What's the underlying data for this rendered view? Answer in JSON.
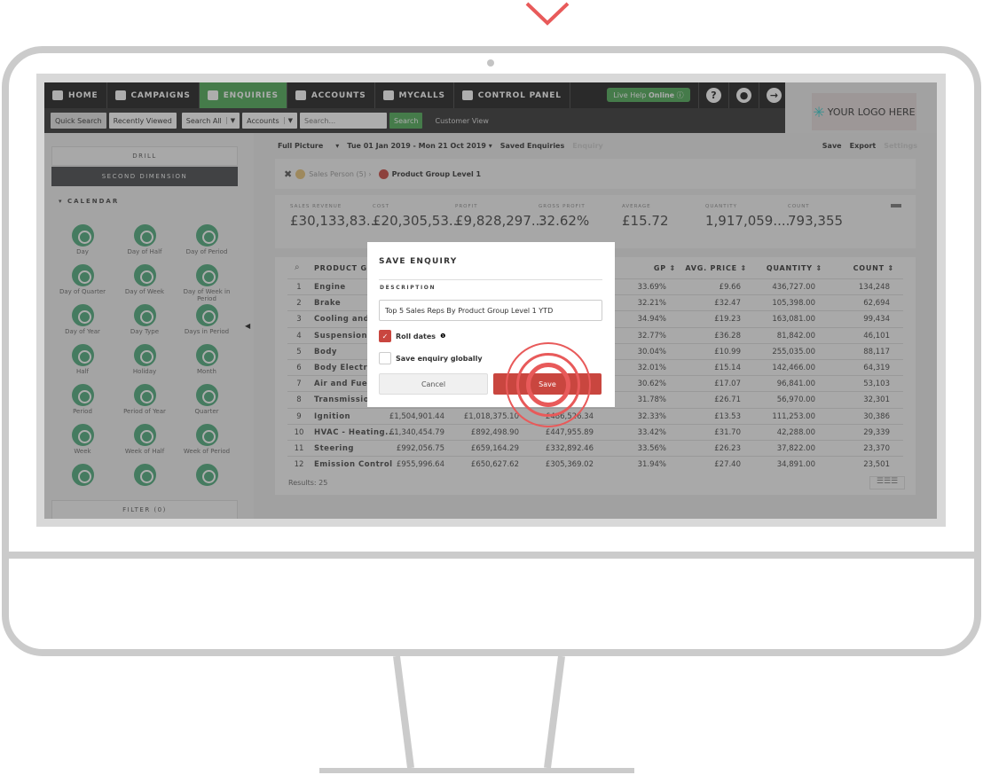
{
  "nav": {
    "items": [
      {
        "label": "HOME",
        "icon": "home-icon"
      },
      {
        "label": "CAMPAIGNS",
        "icon": "campaigns-icon"
      },
      {
        "label": "ENQUIRIES",
        "icon": "enquiries-icon",
        "active": true
      },
      {
        "label": "ACCOUNTS",
        "icon": "bank-icon"
      },
      {
        "label": "MYCALLS",
        "icon": "mycalls-icon"
      },
      {
        "label": "CONTROL PANEL",
        "icon": "control-panel-icon"
      }
    ],
    "live_help": "Live Help",
    "live_help_status": "Online",
    "help": "?",
    "logo_text": "YOUR LOGO HERE"
  },
  "subnav": {
    "quick_search": "Quick Search",
    "recently_viewed": "Recently Viewed",
    "search_all": "Search All",
    "accounts": "Accounts",
    "search_placeholder": "Search...",
    "search_button": "Search",
    "customer_view": "Customer View"
  },
  "sidebar": {
    "drill": "DRILL",
    "second_dimension": "SECOND DIMENSION",
    "calendar": "CALENDAR",
    "filter": "FILTER (0)",
    "items": [
      "Day",
      "Day of Half",
      "Day of Period",
      "Day of Quarter",
      "Day of Week",
      "Day of Week in Period",
      "Day of Year",
      "Day Type",
      "Days in Period",
      "Half",
      "Holiday",
      "Month",
      "Period",
      "Period of Year",
      "Quarter",
      "Week",
      "Week of Half",
      "Week of Period",
      "",
      "",
      ""
    ]
  },
  "toolbar": {
    "full_picture": "Full Picture",
    "date_range": "Tue 01 Jan 2019 - Mon 21 Oct 2019",
    "saved_enquiries": "Saved Enquiries",
    "enquiry": "Enquiry",
    "save": "Save",
    "export": "Export",
    "settings": "Settings"
  },
  "breadcrumb": {
    "sales_person": "Sales Person (5) ›",
    "product_group": "Product Group Level 1"
  },
  "kpis": [
    {
      "label": "SALES REVENUE",
      "value": "£30,133,83..."
    },
    {
      "label": "COST",
      "value": "£20,305,53..."
    },
    {
      "label": "PROFIT",
      "value": "£9,828,297..."
    },
    {
      "label": "GROSS PROFIT",
      "value": "32.62%"
    },
    {
      "label": "AVERAGE",
      "value": "£15.72"
    },
    {
      "label": "QUANTITY",
      "value": "1,917,059...."
    },
    {
      "label": "COUNT",
      "value": "793,355"
    }
  ],
  "table": {
    "headers": [
      "PRODUCT GR",
      "GP",
      "AVG. PRICE",
      "QUANTITY",
      "COUNT"
    ],
    "rows": [
      [
        "1",
        "Engine",
        "",
        "",
        "",
        "33.69%",
        "£9.66",
        "436,727.00",
        "134,248"
      ],
      [
        "2",
        "Brake",
        "",
        "",
        "",
        "32.21%",
        "£32.47",
        "105,398.00",
        "62,694"
      ],
      [
        "3",
        "Cooling and D",
        "",
        "",
        "",
        "34.94%",
        "£19.23",
        "163,081.00",
        "99,434"
      ],
      [
        "4",
        "Suspension",
        "",
        "",
        "",
        "32.77%",
        "£36.28",
        "81,842.00",
        "46,101"
      ],
      [
        "5",
        "Body",
        "",
        "",
        "",
        "30.04%",
        "£10.99",
        "255,035.00",
        "88,117"
      ],
      [
        "6",
        "Body Electric",
        "",
        "",
        "",
        "32.01%",
        "£15.14",
        "142,466.00",
        "64,319"
      ],
      [
        "7",
        "Air and Fuel D",
        "",
        "",
        "",
        "30.62%",
        "£17.07",
        "96,841.00",
        "53,103"
      ],
      [
        "8",
        "Transmission",
        "",
        "",
        "",
        "31.78%",
        "£26.71",
        "56,970.00",
        "32,301"
      ],
      [
        "9",
        "Ignition",
        "£1,504,901.44",
        "£1,018,375.10",
        "£486,526.34",
        "32.33%",
        "£13.53",
        "111,253.00",
        "30,386"
      ],
      [
        "10",
        "HVAC - Heating...",
        "£1,340,454.79",
        "£892,498.90",
        "£447,955.89",
        "33.42%",
        "£31.70",
        "42,288.00",
        "29,339"
      ],
      [
        "11",
        "Steering",
        "£992,056.75",
        "£659,164.29",
        "£332,892.46",
        "33.56%",
        "£26.23",
        "37,822.00",
        "23,370"
      ],
      [
        "12",
        "Emission Control",
        "£955,996.64",
        "£650,627.62",
        "£305,369.02",
        "31.94%",
        "£27.40",
        "34,891.00",
        "23,501"
      ]
    ],
    "results": "Results: 25"
  },
  "modal": {
    "title": "SAVE ENQUIRY",
    "description_label": "DESCRIPTION",
    "description_value": "Top 5 Sales Reps By Product Group Level 1 YTD",
    "roll_dates": "Roll dates",
    "roll_dates_checked": true,
    "save_globally": "Save enquiry globally",
    "save_globally_checked": false,
    "cancel": "Cancel",
    "save": "Save"
  },
  "colors": {
    "accent_green": "#4caa55",
    "save_red": "#c9463f",
    "click_ring": "#e85a5a"
  }
}
